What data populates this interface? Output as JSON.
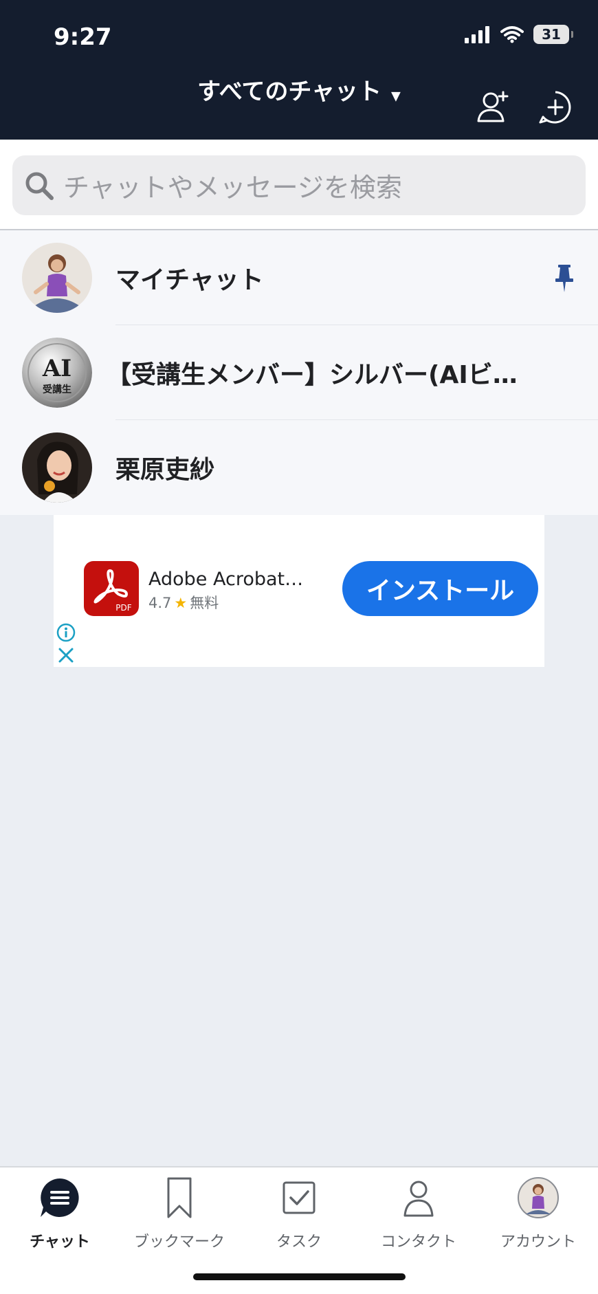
{
  "status_bar": {
    "time": "9:27",
    "battery": "31"
  },
  "header": {
    "title": "すべてのチャット"
  },
  "search": {
    "placeholder": "チャットやメッセージを検索"
  },
  "chats": [
    {
      "name": "マイチャット",
      "pinned": true
    },
    {
      "name": "【受講生メンバー】シルバー(AIビ…",
      "avatar_text": "AI",
      "avatar_subtext": "受講生"
    },
    {
      "name": "栗原吏紗"
    }
  ],
  "ad": {
    "app_name": "Adobe Acrobat…",
    "rating": "4.7",
    "price": "無料",
    "icon_label": "PDF",
    "install_label": "インストール"
  },
  "tabbar": {
    "items": [
      {
        "label": "チャット",
        "icon": "chat-icon",
        "active": true
      },
      {
        "label": "ブックマーク",
        "icon": "bookmark-icon"
      },
      {
        "label": "タスク",
        "icon": "task-icon"
      },
      {
        "label": "コンタクト",
        "icon": "contact-icon"
      },
      {
        "label": "アカウント",
        "icon": "account-avatar"
      }
    ]
  },
  "colors": {
    "header_bg": "#141d2e",
    "accent_blue": "#1a73e8",
    "pin_blue": "#2c4f94",
    "adobe_red": "#c4100d"
  }
}
